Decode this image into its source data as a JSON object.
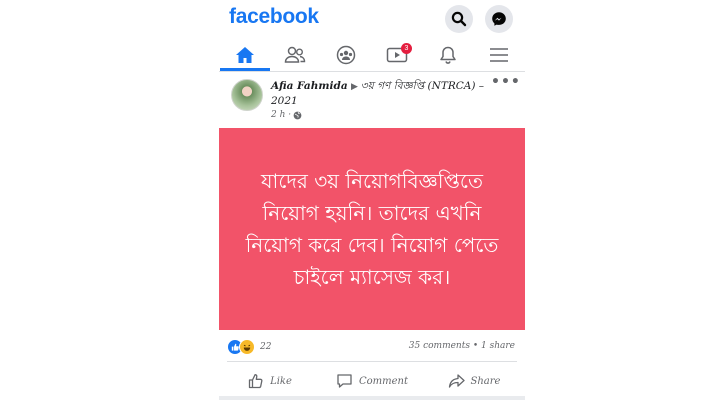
{
  "header": {
    "logo": "facebook",
    "search_icon": "search-icon",
    "messenger_icon": "messenger-icon"
  },
  "nav": {
    "items": [
      {
        "name": "home",
        "icon": "home-icon",
        "active": true
      },
      {
        "name": "friends",
        "icon": "friends-icon",
        "active": false
      },
      {
        "name": "groups",
        "icon": "groups-icon",
        "active": false
      },
      {
        "name": "watch",
        "icon": "video-icon",
        "active": false,
        "badge": "3"
      },
      {
        "name": "notifications",
        "icon": "bell-icon",
        "active": false
      },
      {
        "name": "menu",
        "icon": "menu-icon",
        "active": false
      }
    ]
  },
  "post": {
    "author": "Afia Fahmida",
    "target": "৩য় গণ বিজ্ঞপ্তি (NTRCA) – 2021",
    "time": "2 h ·",
    "more_label": "•••",
    "text": "যাদের ৩য় নিয়োগবিজ্ঞপ্তিতে নিয়োগ হয়নি। তাদের এখনি নিয়োগ করে দেব। নিয়োগ পেতে চাইলে ম্যাসেজ কর।",
    "background_color": "#f25369",
    "reaction_count": "22",
    "comments_shares": "35 comments • 1 share",
    "actions": {
      "like": "Like",
      "comment": "Comment",
      "share": "Share"
    }
  },
  "colors": {
    "brand": "#1877f2",
    "badge": "#e41e3f"
  }
}
